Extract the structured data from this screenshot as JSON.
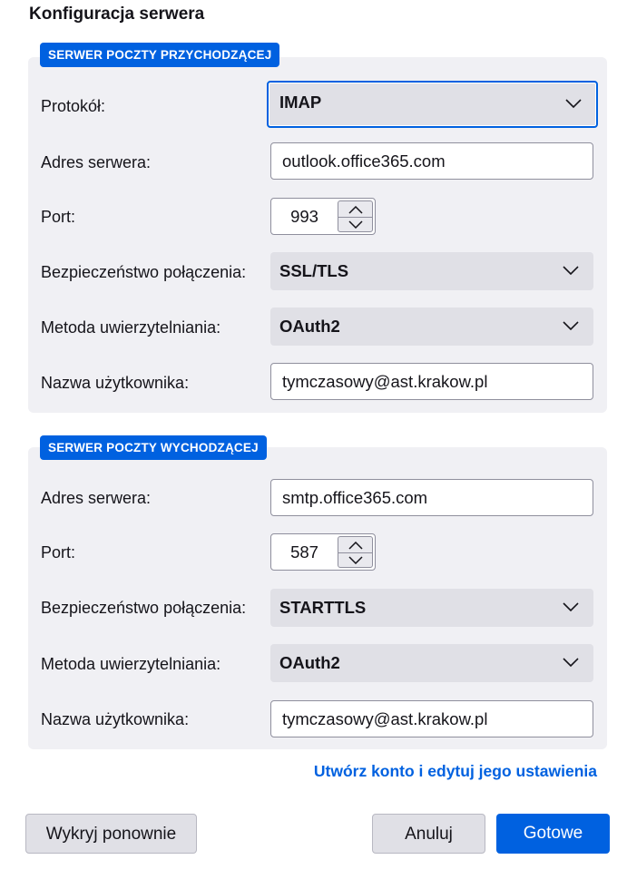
{
  "header": {
    "title": "Konfiguracja serwera"
  },
  "incoming": {
    "badge": "SERWER POCZTY PRZYCHODZĄCEJ",
    "protocol": {
      "label": "Protokół:",
      "value": "IMAP"
    },
    "hostname": {
      "label": "Adres serwera:",
      "value": "outlook.office365.com"
    },
    "port": {
      "label": "Port:",
      "value": "993"
    },
    "security": {
      "label": "Bezpieczeństwo połączenia:",
      "value": "SSL/TLS"
    },
    "auth": {
      "label": "Metoda uwierzytelniania:",
      "value": "OAuth2"
    },
    "username": {
      "label": "Nazwa użytkownika:",
      "value": "tymczasowy@ast.krakow.pl"
    }
  },
  "outgoing": {
    "badge": "SERWER POCZTY WYCHODZĄCEJ",
    "hostname": {
      "label": "Adres serwera:",
      "value": "smtp.office365.com"
    },
    "port": {
      "label": "Port:",
      "value": "587"
    },
    "security": {
      "label": "Bezpieczeństwo połączenia:",
      "value": "STARTTLS"
    },
    "auth": {
      "label": "Metoda uwierzytelniania:",
      "value": "OAuth2"
    },
    "username": {
      "label": "Nazwa użytkownika:",
      "value": "tymczasowy@ast.krakow.pl"
    }
  },
  "advanced_link": "Utwórz konto i edytuj jego ustawienia",
  "buttons": {
    "retest": "Wykryj ponownie",
    "cancel": "Anuluj",
    "done": "Gotowe"
  },
  "colors": {
    "accent": "#0061e0",
    "section_bg": "#f0f0f4",
    "select_bg": "#e0e0e6"
  },
  "icons": {
    "select": "chevron-down-icon",
    "spin_up": "chevron-up-icon",
    "spin_down": "chevron-down-icon"
  }
}
